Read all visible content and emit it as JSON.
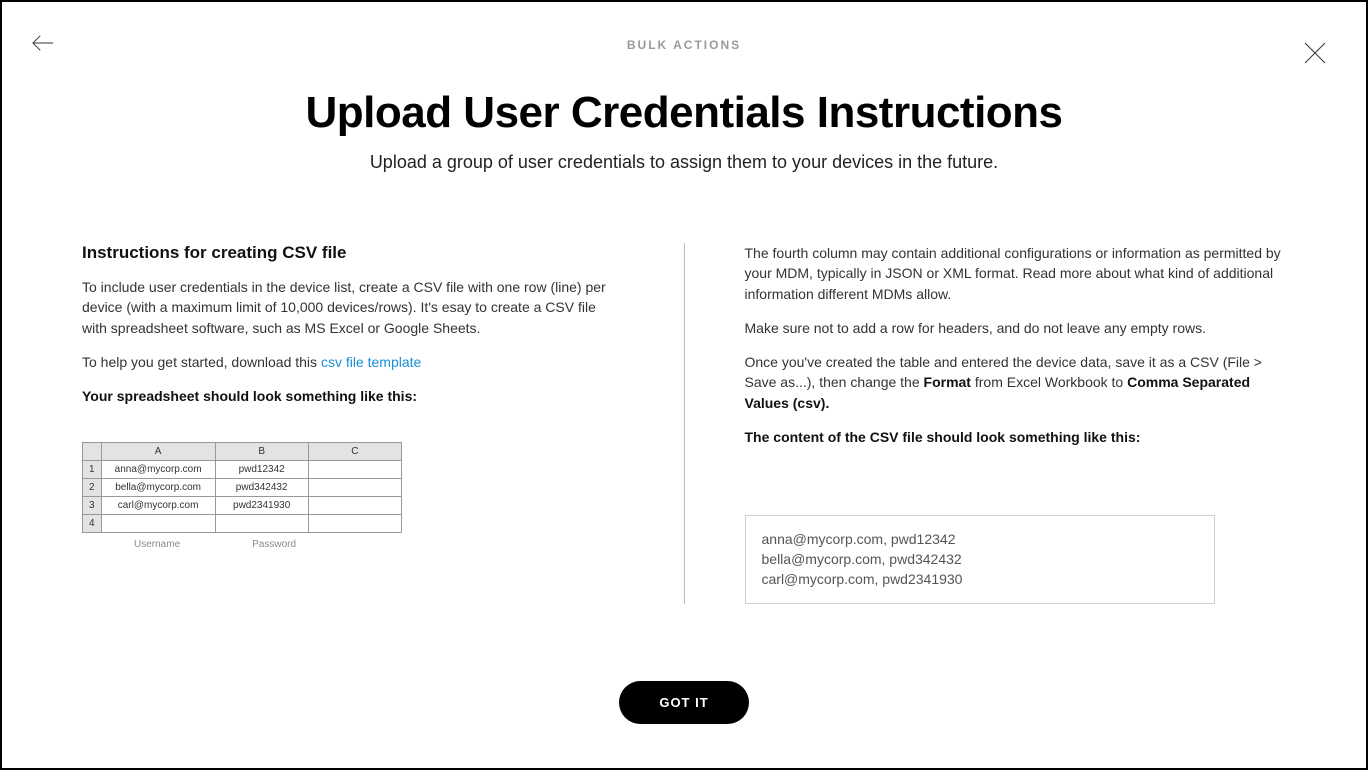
{
  "header": {
    "eyebrow": "BULK ACTIONS",
    "title": "Upload User Credentials Instructions",
    "subtitle": "Upload a group of user credentials to assign them to your devices in the future."
  },
  "left": {
    "heading": "Instructions for creating CSV file",
    "p1": "To include user credentials in the device list, create a CSV file with one row (line) per device (with a maximum limit of 10,000 devices/rows). It's esay to create a CSV file with spreadsheet software, such as MS Excel or Google Sheets.",
    "p2_prefix": "To help you get started, download this ",
    "p2_link": "csv file template",
    "p3_bold": "Your spreadsheet should look something like this:",
    "sheet": {
      "cols": [
        "A",
        "B",
        "C"
      ],
      "rows": [
        {
          "n": "1",
          "a": "anna@mycorp.com",
          "b": "pwd12342",
          "c": ""
        },
        {
          "n": "2",
          "a": "bella@mycorp.com",
          "b": "pwd342432",
          "c": ""
        },
        {
          "n": "3",
          "a": "carl@mycorp.com",
          "b": "pwd2341930",
          "c": ""
        },
        {
          "n": "4",
          "a": "",
          "b": "",
          "c": ""
        }
      ],
      "label_user": "Username",
      "label_pass": "Password"
    }
  },
  "right": {
    "p1": "The fourth column may contain additional configurations or information as permitted by your MDM, typically in JSON or XML format. Read more about what kind of additional information different MDMs allow.",
    "p2": "Make sure not to add a row for headers, and do not leave any empty rows.",
    "p3_a": "Once you've created the table and entered the device data, save it as a CSV (File > Save as...), then change the ",
    "p3_b": "Format",
    "p3_c": " from Excel Workbook to ",
    "p3_d": "Comma Separated Values (csv).",
    "p4_bold": "The content of the CSV file should look something like this:",
    "csv": {
      "l1": "anna@mycorp.com, pwd12342",
      "l2": "bella@mycorp.com, pwd342432",
      "l3": "carl@mycorp.com, pwd2341930"
    }
  },
  "footer": {
    "gotit": "GOT IT"
  }
}
